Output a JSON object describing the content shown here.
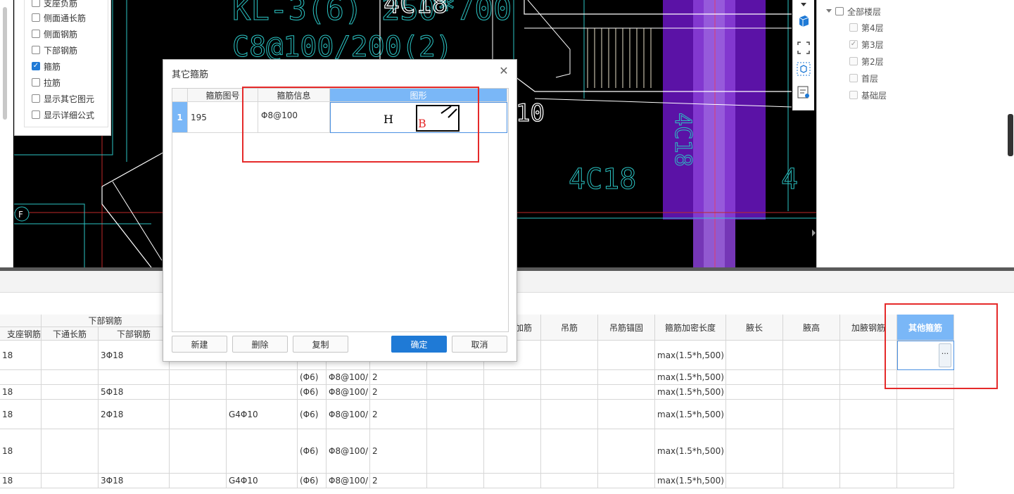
{
  "cad": {
    "texts": [
      "KL-3(6) 250*700",
      "C8@100/200(2)",
      "4C18",
      "10",
      "4C18",
      "4C18",
      "4",
      "F"
    ]
  },
  "check_panel": {
    "items": [
      {
        "label": "支座负筋",
        "checked": false
      },
      {
        "label": "侧面通长筋",
        "checked": false
      },
      {
        "label": "侧面钢筋",
        "checked": false
      },
      {
        "label": "下部钢筋",
        "checked": false
      },
      {
        "label": "箍筋",
        "checked": true
      },
      {
        "label": "拉筋",
        "checked": false
      },
      {
        "label": "显示其它图元",
        "checked": false
      },
      {
        "label": "显示详细公式",
        "checked": false
      }
    ]
  },
  "toolbar": {
    "icons": [
      "chevron-down-icon",
      "cube-icon",
      "select-frame-icon",
      "view-3d-icon",
      "list-settings-icon"
    ]
  },
  "floor_tree": {
    "root": {
      "label": "全部楼层",
      "checked": false
    },
    "floors": [
      {
        "label": "第4层",
        "checked": false
      },
      {
        "label": "第3层",
        "checked": true
      },
      {
        "label": "第2层",
        "checked": false
      },
      {
        "label": "首层",
        "checked": false
      },
      {
        "label": "基础层",
        "checked": false
      }
    ]
  },
  "dialog": {
    "title": "其它箍筋",
    "columns": [
      "箍筋图号",
      "箍筋信息",
      "图形"
    ],
    "rows": [
      {
        "index": "1",
        "figure_no": "195",
        "info": "Φ8@100",
        "shape_h": "H",
        "shape_b": "B"
      }
    ],
    "buttons": {
      "new": "新建",
      "delete": "删除",
      "copy": "复制",
      "ok": "确定",
      "cancel": "取消"
    }
  },
  "grid": {
    "group_header": "下部钢筋",
    "headers_left": [
      "支座钢筋",
      "下通长筋",
      "下部钢筋"
    ],
    "headers_right": [
      "加筋",
      "吊筋",
      "吊筋锚固",
      "箍筋加密长度",
      "腋长",
      "腋高",
      "加腋钢筋",
      "其他箍筋"
    ],
    "rows": [
      {
        "c0": "18",
        "c2": "3Φ18",
        "c4": "",
        "c5": "",
        "c6": "",
        "c7": "",
        "dense": "max(1.5*h,500)"
      },
      {
        "c0": "",
        "c2": "",
        "c4": "",
        "c5": "(Φ6)",
        "c6": "Φ8@100/",
        "c7": "2",
        "dense": "max(1.5*h,500)"
      },
      {
        "c0": "18",
        "c2": "5Φ18",
        "c4": "",
        "c5": "(Φ6)",
        "c6": "Φ8@100/",
        "c7": "2",
        "dense": "max(1.5*h,500)"
      },
      {
        "c0": "18",
        "c2": "2Φ18",
        "c4": "G4Φ10",
        "c5": "(Φ6)",
        "c6": "Φ8@100/",
        "c7": "2",
        "dense": "max(1.5*h,500)"
      },
      {
        "c0": "18",
        "c2": "",
        "c4": "",
        "c5": "(Φ6)",
        "c6": "Φ8@100/",
        "c7": "2",
        "dense": "max(1.5*h,500)"
      },
      {
        "c0": "18",
        "c2": "3Φ18",
        "c4": "G4Φ10",
        "c5": "(Φ6)",
        "c6": "Φ8@100/",
        "c7": "2",
        "dense": "max(1.5*h,500)"
      }
    ],
    "ellipsis": "···"
  },
  "colors": {
    "accent": "#1f7ad6",
    "highlight_header": "#7ab7f7",
    "annotation_red": "#e52a2a",
    "cad_cyan": "#2bc4c4",
    "cad_purple": "#6d1fb8"
  }
}
